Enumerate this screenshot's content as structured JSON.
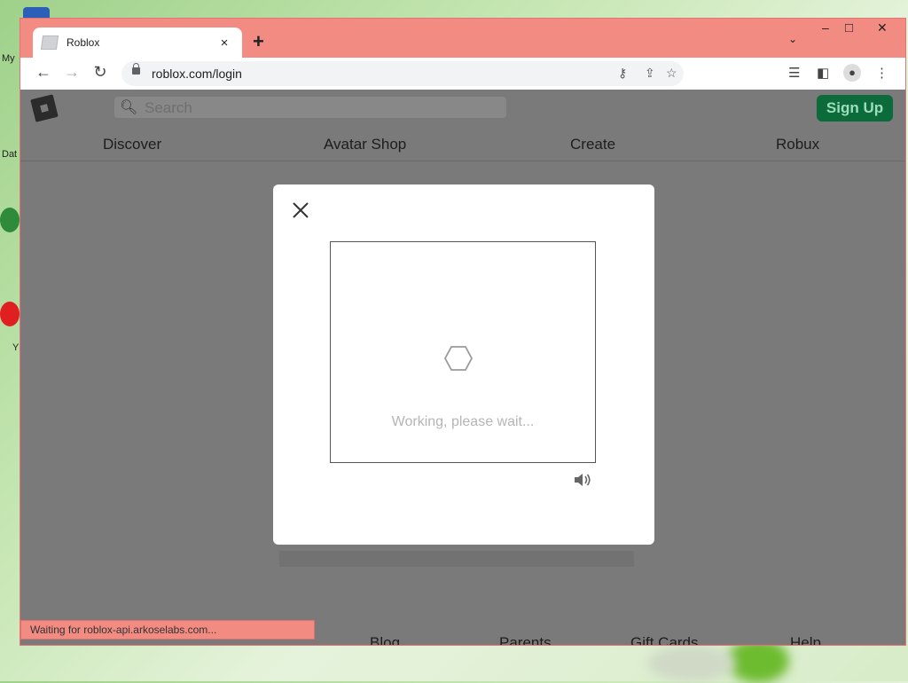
{
  "desktop": {
    "icon_labels": [
      "My",
      "Dat",
      "Y"
    ]
  },
  "browser": {
    "tab": {
      "title": "Roblox",
      "close": "×"
    },
    "new_tab": "+",
    "window_controls": {
      "minimize": "–",
      "maximize": "□",
      "close": "✕"
    },
    "tab_menu": "⌄",
    "nav": {
      "back": "←",
      "forward": "→",
      "reload": "↻"
    },
    "address": {
      "url": "roblox.com/login"
    },
    "status": "Waiting for roblox-api.arkoselabs.com..."
  },
  "page": {
    "search_placeholder": "Search",
    "signup_label": "Sign Up",
    "nav_links": [
      "Discover",
      "Avatar Shop",
      "Create",
      "Robux"
    ],
    "footer_links": [
      "Blog",
      "Parents",
      "Gift Cards",
      "Help"
    ]
  },
  "modal": {
    "close": "✕",
    "status_text": "Working, please wait..."
  }
}
